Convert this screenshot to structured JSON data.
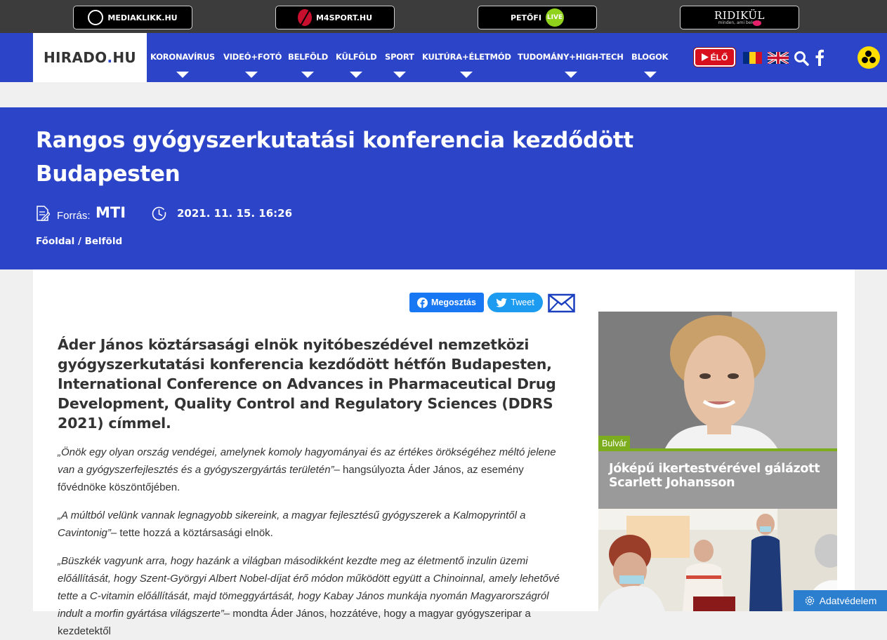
{
  "partners": {
    "mediaklikk": "MEDIAKLIKK.HU",
    "m4sport": "M4SPORT.HU",
    "petofi": "PETŐFI",
    "petofi_live": "LIVE",
    "ridikul": "RIDIKÜL",
    "ridikul_tagline": "minden, ami beletér"
  },
  "nav": {
    "logo_main": "HIRADO",
    "logo_dot": ".",
    "logo_tld": "HU",
    "items": [
      "KORONAVÍRUS",
      "VIDEÓ+FOTÓ",
      "BELFÖLD",
      "KÜLFÖLD",
      "SPORT",
      "KULTÚRA+ÉLETMÓD",
      "TUDOMÁNY+HIGH-TECH",
      "BLOGOK"
    ],
    "live_label": "ÉLŐ"
  },
  "article": {
    "title": "Rangos gyógyszerkutatási konferencia kezdődött Budapesten",
    "source_label": "Forrás:",
    "source": "MTI",
    "date": "2021. 11. 15. 16:26",
    "breadcrumb_home": "Főoldal",
    "breadcrumb_sep": " / ",
    "breadcrumb_section": "Belföld",
    "lead": "Áder János köztársasági elnök nyitóbeszédével nemzetközi gyógyszerkutatási konferencia kezdődött hétfőn Budapesten, International Conference on Advances in Pharmaceutical Drug Development, Quality Control and Regulatory Sciences (DDRS 2021) címmel.",
    "p1_quote": "„Önök egy olyan ország vendégei, amelynek komoly hagyományai és az értékes örökségéhez méltó jelene van a gyógyszerfejlesztés és a gyógyszergyártás területén”",
    "p1_rest": "– hangsúlyozta Áder János, az esemény fővédnöke köszöntőjében.",
    "p2_quote": "„A múltból velünk vannak legnagyobb sikereink, a magyar fejlesztésű gyógyszerek a Kalmopyrintől a Cavintonig”",
    "p2_rest": "– tette hozzá a köztársasági elnök.",
    "p3_quote": "„Büszkék vagyunk arra, hogy hazánk a világban másodikként kezdte meg az életmentő inzulin üzemi előállítását, hogy Szent-Györgyi Albert Nobel-díjat érő módon működött együtt a Chinoinnal, amely lehetővé tette a C-vitamin előállítását, majd tömeggyártását, hogy Kabay János munkája nyomán Magyarországról indult a morfin gyártása világszerte”",
    "p3_rest": "– mondta Áder János, hozzátéve, hogy a magyar gyógyszeripar a kezdetektől"
  },
  "share": {
    "facebook": "Megosztás",
    "tweet": "Tweet"
  },
  "sidebar": {
    "card1_tag": "Bulvár",
    "card1_title": "Jóképű ikertestvérével gálázott Scarlett Johansson"
  },
  "consent": {
    "label": "Adatvédelem"
  },
  "colors": {
    "brand_blue": "#2c44c8",
    "live_red": "#d8101e",
    "tag_green": "#7cad1e",
    "facebook": "#1877f2",
    "twitter": "#1d9bf0",
    "consent_blue": "#2c7fcf"
  }
}
